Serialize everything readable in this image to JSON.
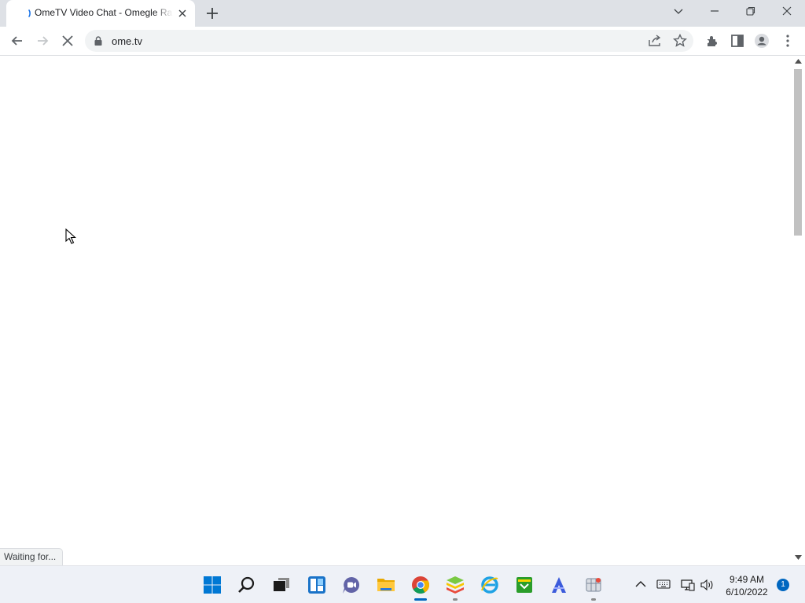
{
  "browser": {
    "tab": {
      "title": "OmeTV Video Chat - Omegle Random Chat Alternative"
    },
    "address_bar": {
      "url": "ome.tv"
    },
    "status_text": "Waiting for..."
  },
  "icons": {
    "tab_strip": [
      "favicon-icon",
      "tab-close-icon",
      "new-tab-icon",
      "tab-search-icon",
      "minimize-icon",
      "restore-icon",
      "close-window-icon"
    ],
    "toolbar": [
      "back-icon",
      "forward-icon",
      "stop-icon",
      "lock-icon",
      "share-icon",
      "bookmark-star-icon",
      "extensions-icon",
      "side-panel-icon",
      "profile-icon",
      "menu-icon"
    ],
    "taskbar": [
      "start-icon",
      "search-icon",
      "task-view-icon",
      "widgets-icon",
      "chat-icon",
      "file-explorer-icon",
      "chrome-icon",
      "bluestacks-icon",
      "internet-explorer-icon",
      "green-app-icon",
      "vector-app-icon",
      "network-app-icon"
    ],
    "tray": [
      "show-hidden-icons-icon",
      "keyboard-icon",
      "network-icon",
      "volume-icon"
    ]
  },
  "colors": {
    "tab_strip_bg": "#dee1e6",
    "omnibox_bg": "#f1f3f4",
    "taskbar_bg": "#eef1f7",
    "accent_blue": "#0067c0"
  },
  "taskbar": {
    "clock": {
      "time": "9:49 AM",
      "date": "6/10/2022"
    },
    "notification_count": "1"
  }
}
